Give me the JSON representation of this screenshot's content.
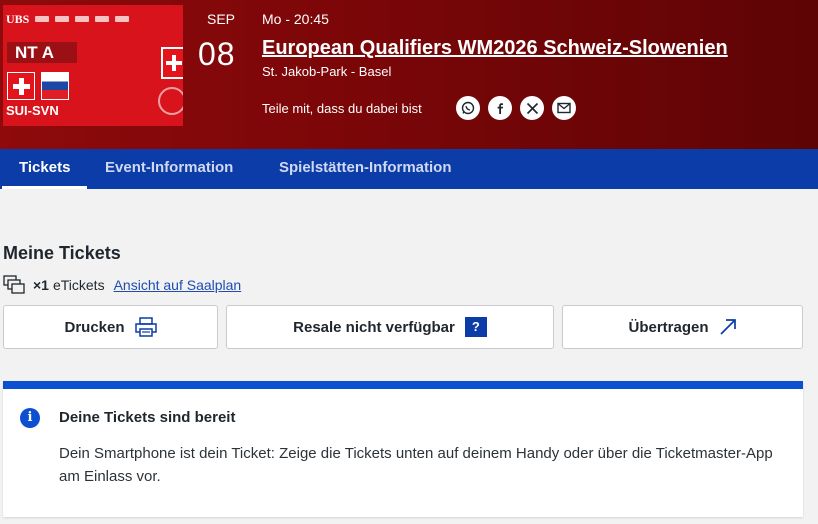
{
  "event": {
    "image": {
      "sponsor_main": "UBS",
      "team_badge": "NT A",
      "match_code": "SUI-SVN"
    },
    "month": "SEP",
    "day": "08",
    "time": "Mo - 20:45",
    "title": "European Qualifiers WM2026 Schweiz-Slowenien",
    "venue": "St. Jakob-Park - Basel",
    "share_label": "Teile mit, dass du dabei bist",
    "share_icons": [
      "whatsapp-icon",
      "facebook-icon",
      "x-icon",
      "email-icon"
    ]
  },
  "tabs": [
    {
      "label": "Tickets",
      "active": true
    },
    {
      "label": "Event-Information",
      "active": false
    },
    {
      "label": "Spielstätten-Information",
      "active": false
    }
  ],
  "tickets": {
    "heading": "Meine Tickets",
    "count": "×1",
    "kind": "eTickets",
    "seatmap_link": "Ansicht auf Saalplan"
  },
  "actions": {
    "print": "Drucken",
    "resale": "Resale nicht verfügbar",
    "resale_help": "?",
    "transfer": "Übertragen"
  },
  "notice": {
    "title": "Deine Tickets sind bereit",
    "text": "Dein Smartphone ist dein Ticket: Zeige die Tickets unten auf deinem Handy oder über die Ticketmaster-App am Einlass vor.",
    "accent_color": "#0c4fd0"
  },
  "colors": {
    "header_bg": "#7a0608",
    "nav_bg": "#0c3ca8",
    "link": "#1f4cb3"
  }
}
